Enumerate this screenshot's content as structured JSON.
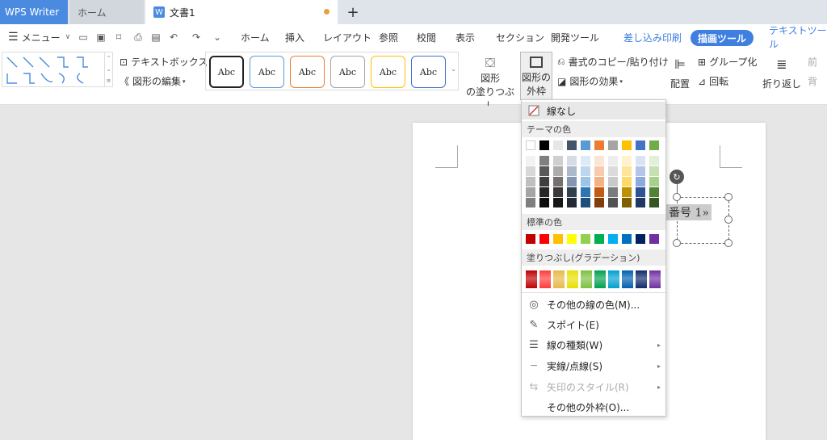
{
  "tabs": {
    "app": "WPS Writer",
    "home": "ホーム",
    "doc": "文書1",
    "doc_icon": "W",
    "plus": "+"
  },
  "menu": {
    "menu_label": "メニュー",
    "items": [
      "ホーム",
      "挿入",
      "レイアウト",
      "参照",
      "校閲",
      "表示",
      "セクション",
      "開発ツール"
    ],
    "mail_merge": "差し込み印刷",
    "draw_tool": "描画ツール",
    "text_tool": "テキストツール"
  },
  "ribbon": {
    "textbox": "テキストボックス",
    "edit_shape": "図形の編集",
    "style_label": "Abc",
    "style_colors": [
      "#222222",
      "#5b9bd5",
      "#ed7d31",
      "#a5a5a5",
      "#ffc000",
      "#4472c4"
    ],
    "fill_line1": "図形",
    "fill_line2": "の塗りつぶし",
    "outline_line1": "図形の",
    "outline_line2": "外枠",
    "format_copy": "書式のコピー/貼り付け",
    "shape_effect": "図形の効果",
    "arrange": "配置",
    "group": "グループ化",
    "rotate": "回転",
    "wrap": "折り返し",
    "front": "前",
    "back": "背"
  },
  "document": {
    "text": "番号 1»"
  },
  "dropdown": {
    "no_line": "線なし",
    "theme_colors_title": "テーマの色",
    "theme_top": [
      "#ffffff",
      "#000000",
      "#e7e6e6",
      "#44546a",
      "#5b9bd5",
      "#ed7d31",
      "#a5a5a5",
      "#ffc000",
      "#4472c4",
      "#70ad47"
    ],
    "theme_shades": [
      [
        "#f2f2f2",
        "#7f7f7f",
        "#d0cece",
        "#d6dce4",
        "#deebf6",
        "#fbe5d5",
        "#ededed",
        "#fff2cc",
        "#dae3f3",
        "#e2efd9"
      ],
      [
        "#d8d8d8",
        "#595959",
        "#aeabab",
        "#adb9ca",
        "#bdd7ee",
        "#f7cbac",
        "#dbdbdb",
        "#fee599",
        "#b4c6e7",
        "#c5e0b3"
      ],
      [
        "#bfbfbf",
        "#3f3f3f",
        "#757070",
        "#8496b0",
        "#9dc3e6",
        "#f4b183",
        "#c9c9c9",
        "#ffd965",
        "#8eaadb",
        "#a8d08d"
      ],
      [
        "#a5a5a5",
        "#262626",
        "#3a3838",
        "#323f4f",
        "#2e75b5",
        "#c55a11",
        "#7b7b7b",
        "#bf9000",
        "#2f5496",
        "#538135"
      ],
      [
        "#7f7f7f",
        "#0c0c0c",
        "#171616",
        "#222a35",
        "#1e4e79",
        "#833c0b",
        "#525252",
        "#7f6000",
        "#1f3864",
        "#375623"
      ]
    ],
    "standard_title": "標準の色",
    "standard_colors": [
      "#c00000",
      "#ff0000",
      "#ffc000",
      "#ffff00",
      "#92d050",
      "#00b050",
      "#00b0f0",
      "#0070c0",
      "#002060",
      "#7030a0"
    ],
    "gradient_title": "塗りつぶし(グラデーション)",
    "gradient_colors": [
      "#c00000",
      "#ff3b3b",
      "#e8b84a",
      "#e8e000",
      "#7dc142",
      "#00a050",
      "#00a0d0",
      "#0060b0",
      "#102a6a",
      "#7030a0"
    ],
    "more_colors": "その他の線の色(M)...",
    "eyedropper": "スポイト(E)",
    "line_type": "線の種類(W)",
    "dash_type": "実線/点線(S)",
    "arrow_style": "矢印のスタイル(R)",
    "more_outline": "その他の外枠(O)..."
  }
}
